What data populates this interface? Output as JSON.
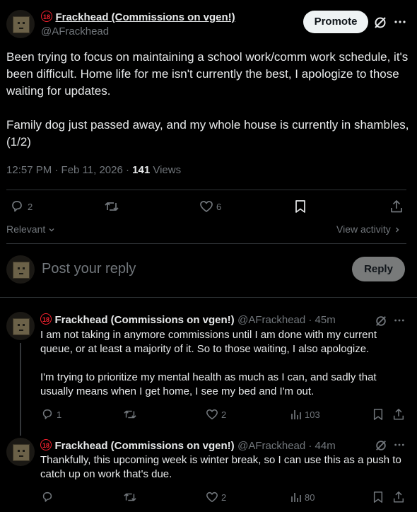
{
  "main_post": {
    "author_name": "Frackhead (Commissions on vgen!)",
    "handle": "@AFrackhead",
    "promote_label": "Promote",
    "paragraphs": [
      "Been trying to focus on maintaining a school work/comm work schedule, it's been difficult. Home life for me isn't currently the best, I apologize to those waiting for updates.",
      "Family dog just passed away, and my whole house is currently in shambles, (1/2)"
    ],
    "timestamp": "12:57 PM · Feb 11, 2026 · ",
    "views_count": "141",
    "views_label": " Views",
    "replies": "2",
    "likes": "6",
    "sort_label": "Relevant",
    "view_activity": "View activity"
  },
  "composer": {
    "placeholder": "Post your reply",
    "reply_button": "Reply"
  },
  "replies": [
    {
      "author_name": "Frackhead (Commissions on vgen!)",
      "handle_time": "@AFrackhead · 45m",
      "paragraphs": [
        "I am not taking in anymore commissions until I am done with my current queue, or at least a majority of it. So to those waiting, I also apologize.",
        "I'm trying to prioritize my mental health as much as I can, and sadly that usually means when I get home, I see my bed and I'm out."
      ],
      "replies": "1",
      "likes": "2",
      "views": "103"
    },
    {
      "author_name": "Frackhead (Commissions on vgen!)",
      "handle_time": "@AFrackhead · 44m",
      "paragraphs": [
        "Thankfully, this upcoming week is winter break, so I can use this as a push to catch up on work that's due."
      ],
      "replies": "",
      "likes": "2",
      "views": "80"
    }
  ],
  "age_badge": "18",
  "icons": [
    "reply-icon",
    "retweet-icon",
    "like-icon",
    "bookmark-icon",
    "share-icon",
    "views-icon",
    "grok-icon",
    "more-icon",
    "chevron-down-icon",
    "chevron-right-icon"
  ]
}
